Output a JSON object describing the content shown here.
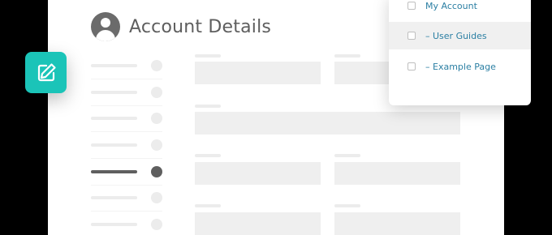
{
  "header": {
    "title": "Account Details"
  },
  "sidebar": {
    "item_count": 7,
    "active_index": 4
  },
  "dropdown": {
    "items": [
      {
        "label": "My Account",
        "highlighted": false
      },
      {
        "label": "– User Guides",
        "highlighted": true
      },
      {
        "label": "– Example Page",
        "highlighted": false
      }
    ]
  },
  "colors": {
    "accent": "#1bc4b8",
    "link": "#2b7fa3",
    "active_nav": "#5f5f5f",
    "placeholder": "#efefef"
  }
}
